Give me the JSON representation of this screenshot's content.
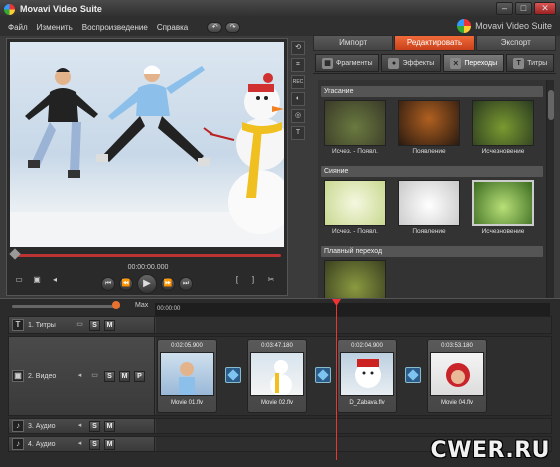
{
  "window": {
    "title": "Movavi Video Suite",
    "minimize": "–",
    "maximize": "□",
    "close": "✕"
  },
  "menu": {
    "items": [
      "Файл",
      "Изменить",
      "Воспроизведение",
      "Справка"
    ],
    "undo": "↶",
    "redo": "↷",
    "brand": "Movavi Video Suite"
  },
  "player": {
    "timecode": "00:00:00.000",
    "side_tools": [
      "⟲",
      "⌗",
      "REC",
      "◐",
      "◎",
      "T"
    ]
  },
  "tabs": {
    "main": [
      {
        "label": "Импорт",
        "active": false
      },
      {
        "label": "Редактировать",
        "active": true
      },
      {
        "label": "Экспорт",
        "active": false
      }
    ],
    "sub": [
      {
        "label": "Фрагменты",
        "icon": "clips-icon",
        "glyph": "▦",
        "active": false
      },
      {
        "label": "Эффекты",
        "icon": "effects-icon",
        "glyph": "●",
        "active": false
      },
      {
        "label": "Переходы",
        "icon": "transitions-icon",
        "glyph": "⨯",
        "active": true
      },
      {
        "label": "Титры",
        "icon": "titles-icon",
        "glyph": "T",
        "active": false
      }
    ]
  },
  "effects": {
    "groups": [
      {
        "title": "Угасание",
        "items": [
          "Исчез. - Появл.",
          "Появление",
          "Исчезновение"
        ]
      },
      {
        "title": "Сияние",
        "items": [
          "Исчез. - Появл.",
          "Появление",
          "Исчезновение"
        ]
      },
      {
        "title": "Плавный переход",
        "items": [
          ""
        ]
      }
    ],
    "selected": "Сияние / Исчезновение"
  },
  "timeline": {
    "zoom_label": "Max",
    "ruler_start": "00:00:00",
    "tracks": [
      {
        "name": "1. Титры",
        "icon": "T"
      },
      {
        "name": "2. Видео",
        "icon": "▣"
      },
      {
        "name": "3. Аудио",
        "icon": "♪"
      },
      {
        "name": "4. Аудио",
        "icon": "♪"
      }
    ],
    "sm": [
      "S",
      "M",
      "P"
    ],
    "clips": [
      {
        "time": "0:02:05.900",
        "name": "Movie 01.flv"
      },
      {
        "time": "0:03:47.180",
        "name": "Movie 02.flv"
      },
      {
        "time": "0:02:04.900",
        "name": "D_Zabava.flv"
      },
      {
        "time": "0:03:53.180",
        "name": "Movie 04.flv"
      }
    ]
  },
  "watermark": "CWER.RU",
  "colors": {
    "accent": "#e8582a",
    "playhead": "#e33333",
    "transition": "#2c5d8a"
  }
}
